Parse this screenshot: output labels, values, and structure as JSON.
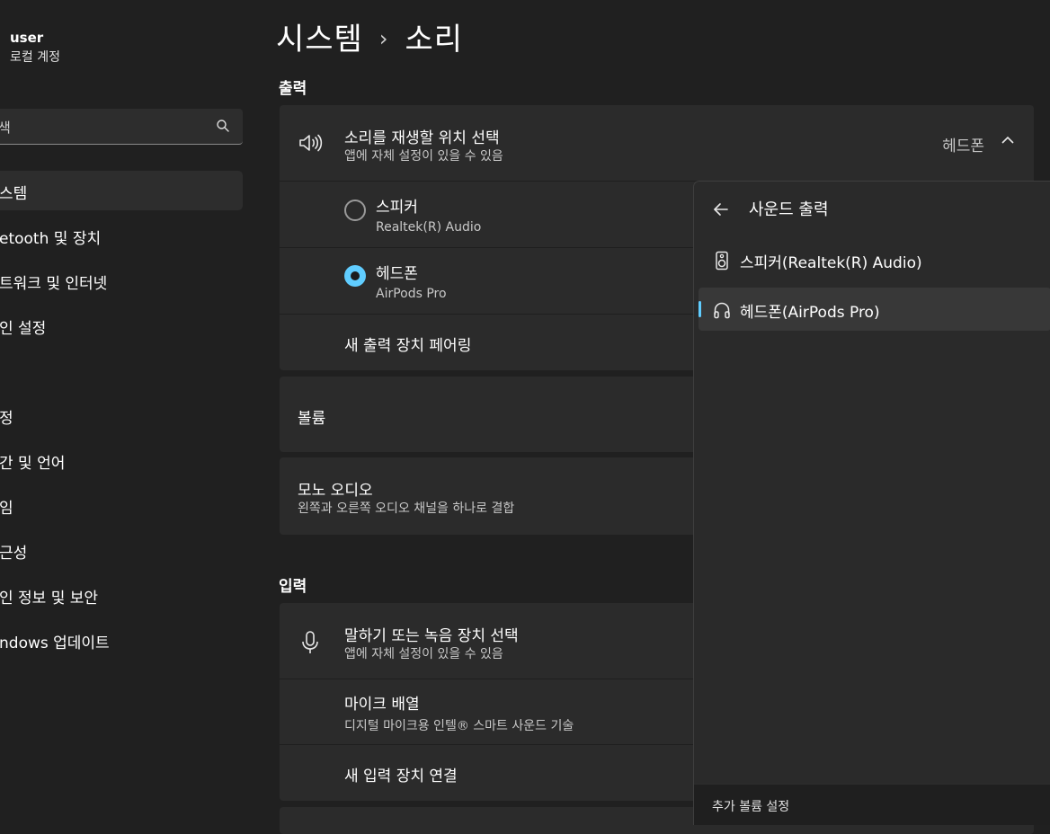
{
  "sidebar": {
    "user_name": "user",
    "user_sub": "로컬 계정",
    "search_text": "색",
    "items": [
      {
        "label": "스템"
      },
      {
        "label": "etooth 및 장치"
      },
      {
        "label": "트워크 및 인터넷"
      },
      {
        "label": "인 설정"
      },
      {
        "label": "정"
      },
      {
        "label": "간 및 언어"
      },
      {
        "label": "임"
      },
      {
        "label": "근성"
      },
      {
        "label": "인 정보 및 보안"
      },
      {
        "label": "ndows 업데이트"
      }
    ]
  },
  "header": {
    "crumb_parent": "시스템",
    "crumb_current": "소리"
  },
  "output": {
    "section_label": "출력",
    "choose": {
      "title": "소리를 재생할 위치 선택",
      "subtitle": "앱에 자체 설정이 있을 수 있음",
      "value": "헤드폰"
    },
    "devices": [
      {
        "name": "스피커",
        "detail": "Realtek(R) Audio",
        "selected": false
      },
      {
        "name": "헤드폰",
        "detail": "AirPods Pro",
        "selected": true
      }
    ],
    "pair_new": "새 출력 장치 페어링",
    "volume_label": "볼륨",
    "mono_title": "모노 오디오",
    "mono_subtitle": "왼쪽과 오른쪽 오디오 채널을 하나로 결합"
  },
  "input": {
    "section_label": "입력",
    "choose": {
      "title": "말하기 또는 녹음 장치 선택",
      "subtitle": "앱에 자체 설정이 있을 수 있음"
    },
    "mic_array": {
      "title": "마이크 배열",
      "subtitle": "디지털 마이크용 인텔® 스마트 사운드 기술"
    },
    "connect_new": "새 입력 장치 연결"
  },
  "flyout": {
    "title": "사운드 출력",
    "items": [
      {
        "label": "스피커(Realtek(R) Audio)",
        "icon": "speaker-icon",
        "selected": false
      },
      {
        "label": "헤드폰(AirPods Pro)",
        "icon": "headphones-icon",
        "selected": true
      }
    ],
    "footer": "추가 볼륨 설정"
  },
  "colors": {
    "accent": "#60cdff",
    "background": "#202020",
    "card": "#2b2b2b"
  }
}
